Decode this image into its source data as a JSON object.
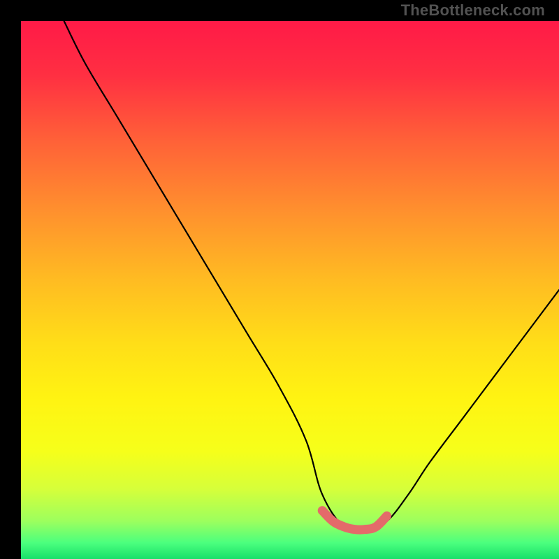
{
  "watermark": "TheBottleneck.com",
  "gradient": {
    "stops": [
      {
        "offset": 0.0,
        "color": "#ff1a47"
      },
      {
        "offset": 0.1,
        "color": "#ff2f42"
      },
      {
        "offset": 0.22,
        "color": "#ff6038"
      },
      {
        "offset": 0.35,
        "color": "#ff8f2e"
      },
      {
        "offset": 0.48,
        "color": "#ffbb22"
      },
      {
        "offset": 0.6,
        "color": "#ffde18"
      },
      {
        "offset": 0.7,
        "color": "#fff312"
      },
      {
        "offset": 0.8,
        "color": "#f6ff1a"
      },
      {
        "offset": 0.87,
        "color": "#d6ff3a"
      },
      {
        "offset": 0.93,
        "color": "#9cff5e"
      },
      {
        "offset": 0.97,
        "color": "#4bff7e"
      },
      {
        "offset": 1.0,
        "color": "#18e06a"
      }
    ]
  },
  "chart_data": {
    "type": "line",
    "title": "",
    "xlabel": "",
    "ylabel": "",
    "xlim": [
      0,
      100
    ],
    "ylim": [
      0,
      100
    ],
    "grid": false,
    "optimum_range_x": [
      56,
      68
    ],
    "series": [
      {
        "name": "bottleneck-curve",
        "x": [
          8,
          12,
          18,
          24,
          30,
          36,
          42,
          48,
          53,
          56,
          60,
          64,
          68,
          72,
          76,
          82,
          88,
          94,
          100
        ],
        "values": [
          100,
          92,
          82,
          72,
          62,
          52,
          42,
          32,
          22,
          12,
          6,
          5,
          7,
          12,
          18,
          26,
          34,
          42,
          50
        ]
      },
      {
        "name": "optimum-band",
        "x": [
          56,
          58,
          60,
          62,
          64,
          66,
          68
        ],
        "values": [
          9,
          7,
          6,
          5.5,
          5.5,
          6,
          8
        ]
      }
    ],
    "annotations": []
  },
  "colors": {
    "curve_stroke": "#000000",
    "optimum_stroke": "#e46a6a",
    "frame": "#000000"
  }
}
